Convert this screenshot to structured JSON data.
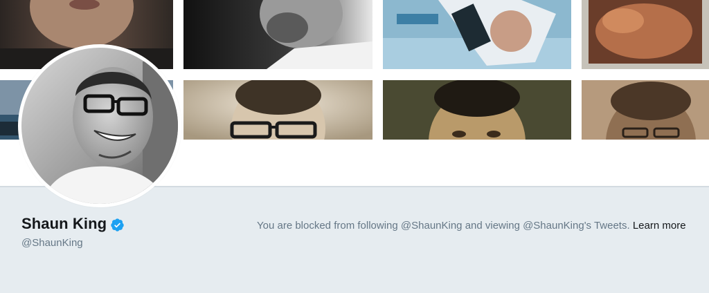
{
  "profile": {
    "name": "Shaun King",
    "handle": "@ShaunKing",
    "verified": true,
    "verified_icon": "verified-badge-icon",
    "verified_color": "#1da1f2"
  },
  "notice": {
    "blocked_text": "You are blocked from following @ShaunKing and viewing @ShaunKing's Tweets.",
    "learn_more_label": "Learn more"
  },
  "colors": {
    "page_background": "#e6ecf0",
    "primary_text": "#14171a",
    "secondary_text": "#657786"
  }
}
